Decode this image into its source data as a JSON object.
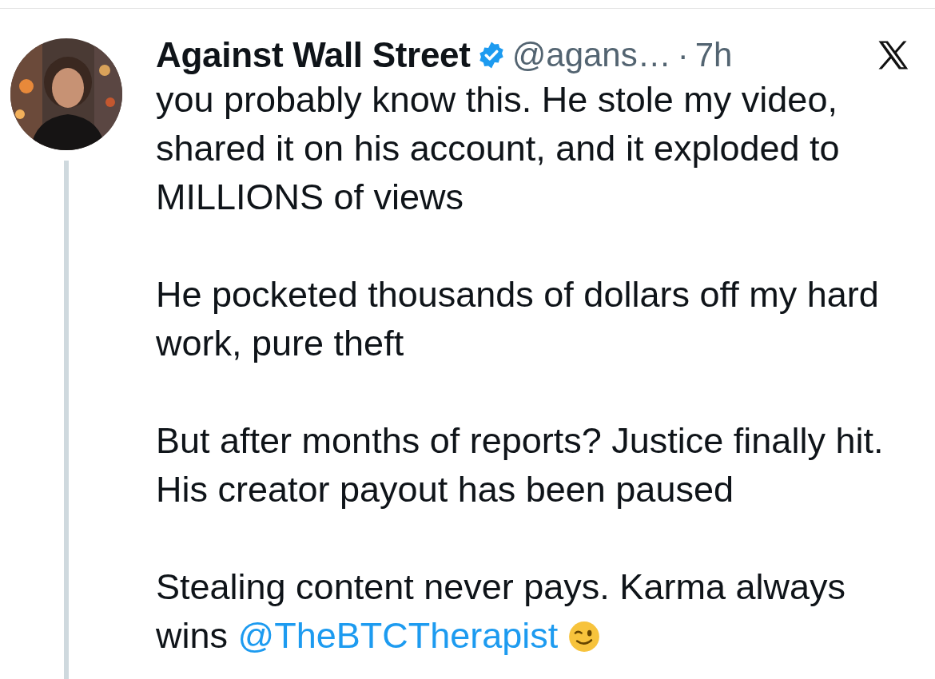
{
  "tweet": {
    "author": {
      "name": "Against Wall Street",
      "verified": true,
      "handle": "@agans…",
      "separator": "·",
      "time": "7h"
    },
    "paragraphs": [
      {
        "text": "you probably know this. He stole my video, shared it on his account, and it exploded to MILLIONS of views"
      },
      {
        "text": "He pocketed thousands of dollars off my hard work, pure theft"
      },
      {
        "text": "But after months of reports? Justice finally hit. His creator payout has been paused"
      },
      {
        "text": "Stealing content never pays. Karma always wins",
        "mention": "@TheBTCTherapist"
      }
    ]
  }
}
